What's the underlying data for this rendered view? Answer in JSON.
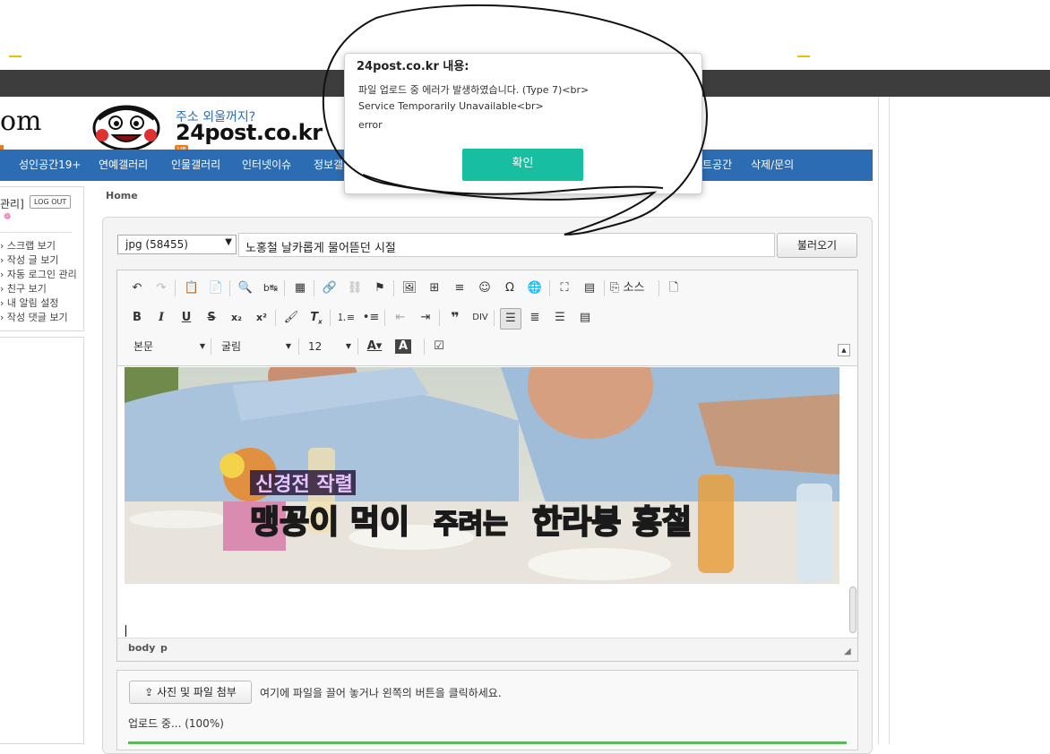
{
  "header": {
    "logo_partial": "om",
    "slogan": "주소 외울꺼지?",
    "domain": "24post.co.kr",
    "up_badge": "UP"
  },
  "nav": {
    "items": [
      "성인공간19+",
      "연예갤러리",
      "인물갤러리",
      "인터넷이슈",
      "정보갤",
      "트공간",
      "삭제/문의"
    ]
  },
  "sidebar": {
    "admin_label": "관리]",
    "logout_label": "LOG OUT",
    "links": [
      "스크랩 보기",
      "작성 글 보기",
      "자동 로그인 관리",
      "친구 보기",
      "내 알림 설정",
      "작성 댓글 보기"
    ]
  },
  "breadcrumb": "Home",
  "form": {
    "category_value": "jpg (58455)",
    "title_value": "노홍철 날카롭게 물어뜯던 시절",
    "load_button": "불러오기"
  },
  "toolbar": {
    "source_label": "소스",
    "format_value": "본문",
    "font_value": "굴림",
    "size_value": "12"
  },
  "image_caption": {
    "line1": "신경전 작렬",
    "part1": "맹꽁이 먹이",
    "part2": "주려는",
    "part3": "한라봉 홍철"
  },
  "statusbar": {
    "path_body": "body",
    "path_p": "p"
  },
  "upload": {
    "attach_button": "사진 및 파일 첨부",
    "hint": "여기에 파일을 끌어 놓거나 왼쪽의 버튼을 클릭하세요.",
    "progress_text": "업로드 중... (100%)",
    "progress": 1.0
  },
  "dialog": {
    "title": "24post.co.kr 내용:",
    "line1": "파일 업로드 중 에러가 발생하였습니다. (Type 7)<br>",
    "line2": "Service Temporarily Unavailable<br>",
    "line3": "error",
    "ok_button": "확인"
  },
  "colors": {
    "nav_bg": "#2c6cb2",
    "topbar_bg": "#3d3d3d",
    "ok_button": "#17bfa0",
    "progress": "#5cb85c"
  }
}
